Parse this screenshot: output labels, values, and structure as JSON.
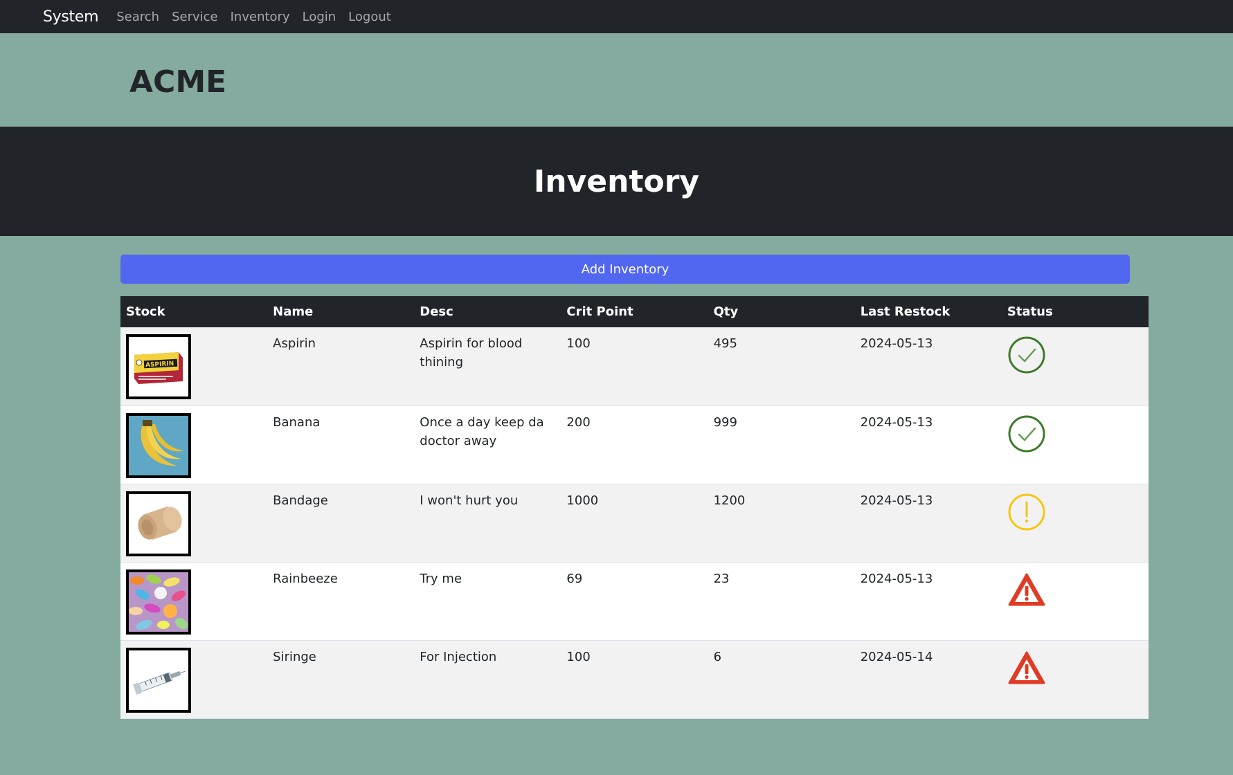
{
  "nav": {
    "brand": "System",
    "links": [
      "Search",
      "Service",
      "Inventory",
      "Login",
      "Logout"
    ]
  },
  "header": {
    "title": "ACME"
  },
  "hero": {
    "title": "Inventory"
  },
  "actions": {
    "add_label": "Add Inventory"
  },
  "table": {
    "columns": [
      "Stock",
      "Name",
      "Desc",
      "Crit Point",
      "Qty",
      "Last Restock",
      "Status"
    ],
    "rows": [
      {
        "name": "Aspirin",
        "desc": "Aspirin for blood thining",
        "crit": "100",
        "qty": "495",
        "restock": "2024-05-13",
        "status": "ok",
        "image": "aspirin-box",
        "image_text": "ASPIRIN"
      },
      {
        "name": "Banana",
        "desc": "Once a day keep da doctor away",
        "crit": "200",
        "qty": "999",
        "restock": "2024-05-13",
        "status": "ok",
        "image": "bananas"
      },
      {
        "name": "Bandage",
        "desc": "I won't hurt you",
        "crit": "1000",
        "qty": "1200",
        "restock": "2024-05-13",
        "status": "warning",
        "image": "bandage-roll"
      },
      {
        "name": "Rainbeeze",
        "desc": "Try me",
        "crit": "69",
        "qty": "23",
        "restock": "2024-05-13",
        "status": "critical",
        "image": "colorful-pills"
      },
      {
        "name": "Siringe",
        "desc": "For Injection",
        "crit": "100",
        "qty": "6",
        "restock": "2024-05-14",
        "status": "critical",
        "image": "syringe"
      }
    ]
  },
  "colors": {
    "page_bg": "#85aa9f",
    "dark": "#212529",
    "accent": "#5167f0",
    "ok": "#3d7a2a",
    "warning": "#f3c614",
    "critical": "#df3b25"
  }
}
